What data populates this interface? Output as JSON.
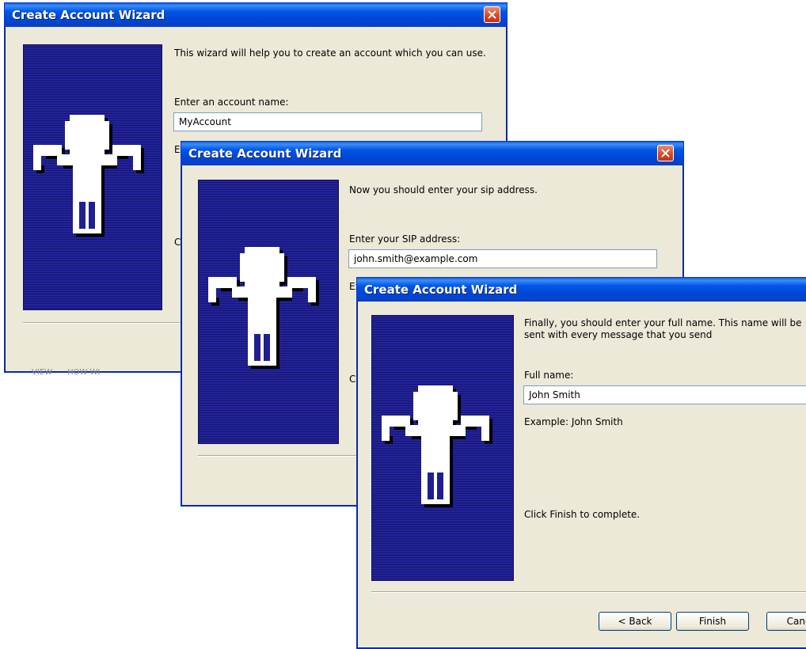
{
  "window1": {
    "title": "Create Account Wizard",
    "intro": "This wizard will help you to create an account which you can use.",
    "field_label": "Enter an account name:",
    "field_value": "MyAccount",
    "example_partial": "Ex",
    "click_partial": "Cl",
    "stray_text": "VIEW      HOW WI"
  },
  "window2": {
    "title": "Create Account Wizard",
    "intro": "Now you should enter your sip address.",
    "field_label": "Enter your SIP address:",
    "field_value": "john.smith@example.com",
    "example_partial": "Ex",
    "click_partial": "Cl"
  },
  "window3": {
    "title": "Create Account Wizard",
    "intro": "Finally, you should enter your full name. This name will be sent with every message that you send",
    "field_label": "Full name:",
    "field_value": "John Smith",
    "example": "Example: John Smith",
    "click_text": "Click Finish to complete.",
    "buttons": {
      "back": "< Back",
      "finish": "Finish",
      "cancel": "Cancel"
    }
  },
  "icons": {
    "close": "close-icon",
    "wizard_figure": "person-figure-icon"
  },
  "colors": {
    "titlebar": "#0055e5",
    "client_bg": "#ece9d8",
    "panel": "#1f1f8f",
    "close": "#d9451e"
  }
}
